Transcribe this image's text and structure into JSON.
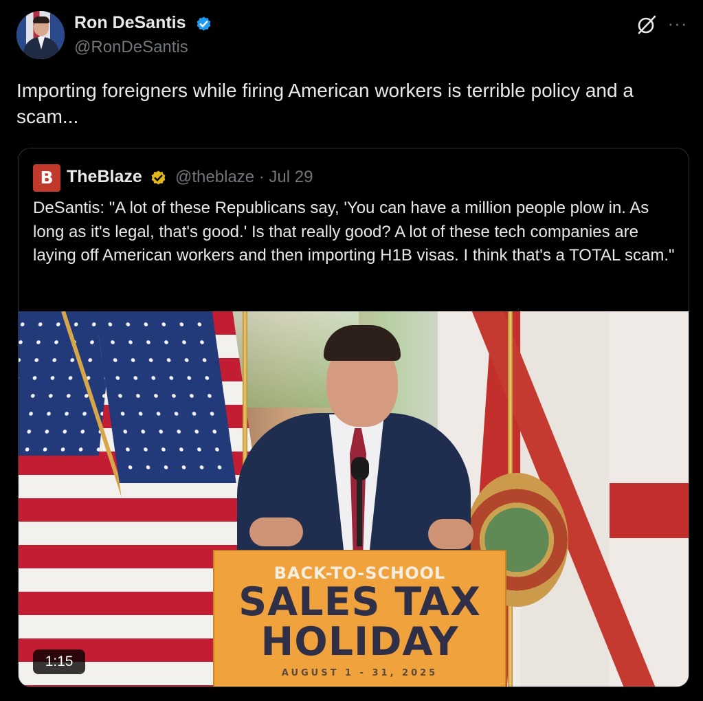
{
  "author": {
    "name": "Ron DeSantis",
    "handle": "@RonDeSantis",
    "verified_badge_color": "#1d9bf0"
  },
  "tweet": {
    "text": "Importing foreigners while firing American workers is terrible policy and a scam..."
  },
  "quoted": {
    "avatar_letter": "B",
    "name": "TheBlaze",
    "handle_line": "@theblaze · Jul 29",
    "badge_color": "#e2b719",
    "text": "DeSantis: \"A lot of these Republicans say, 'You can have a million people plow in. As long as it's legal, that's good.' Is that really good? A lot of these tech companies are laying off American workers and then importing H1B visas. I think that's a TOTAL scam.\"",
    "media": {
      "podium_line1": "BACK-TO-SCHOOL",
      "podium_line2": "SALES TAX",
      "podium_line3": "HOLIDAY",
      "podium_line4": "AUGUST 1 - 31, 2025",
      "duration": "1:15"
    }
  },
  "icons": {
    "grok": "grok-icon",
    "more": "more-icon",
    "verified": "verified-badge-icon"
  },
  "colors": {
    "background": "#000000",
    "text": "#e7e9ea",
    "secondary": "#71767b",
    "border": "#2f3336"
  }
}
